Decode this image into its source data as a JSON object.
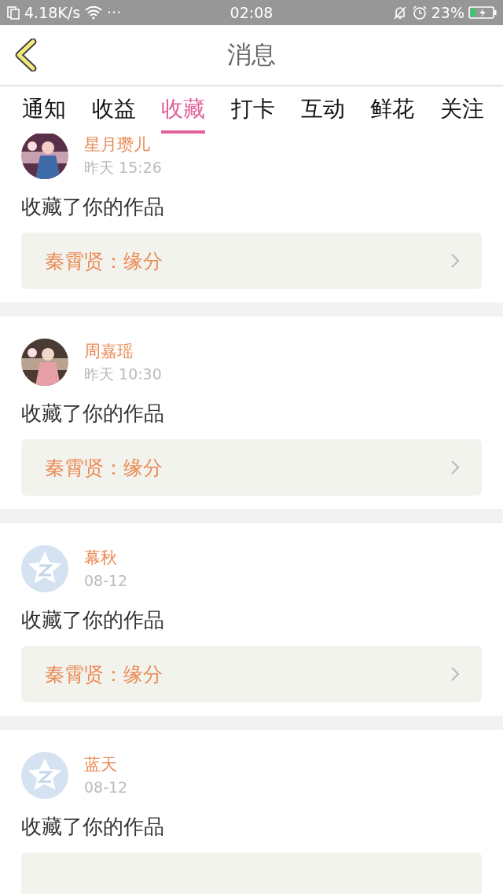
{
  "status_bar": {
    "speed": "4.18K/s",
    "more": "···",
    "time": "02:08",
    "battery": "23%"
  },
  "header": {
    "title": "消息"
  },
  "tabs": [
    {
      "label": "通知",
      "selected": false
    },
    {
      "label": "收益",
      "selected": false
    },
    {
      "label": "收藏",
      "selected": true
    },
    {
      "label": "打卡",
      "selected": false
    },
    {
      "label": "互动",
      "selected": false
    },
    {
      "label": "鲜花",
      "selected": false
    },
    {
      "label": "关注",
      "selected": false
    }
  ],
  "messages": [
    {
      "name": "星月瓒儿",
      "time": "昨天 15:26",
      "text": "收藏了你的作品",
      "work": "秦霄贤：缘分"
    },
    {
      "name": "周嘉瑶",
      "time": "昨天 10:30",
      "text": "收藏了你的作品",
      "work": "秦霄贤：缘分"
    },
    {
      "avatar": {
        "kind": "default"
      },
      "name": "幕秋",
      "time": "08-12",
      "text": "收藏了你的作品",
      "work": "秦霄贤：缘分"
    },
    {
      "avatar": {
        "kind": "default"
      },
      "name": "蓝天",
      "time": "08-12",
      "text": "收藏了你的作品"
    }
  ]
}
